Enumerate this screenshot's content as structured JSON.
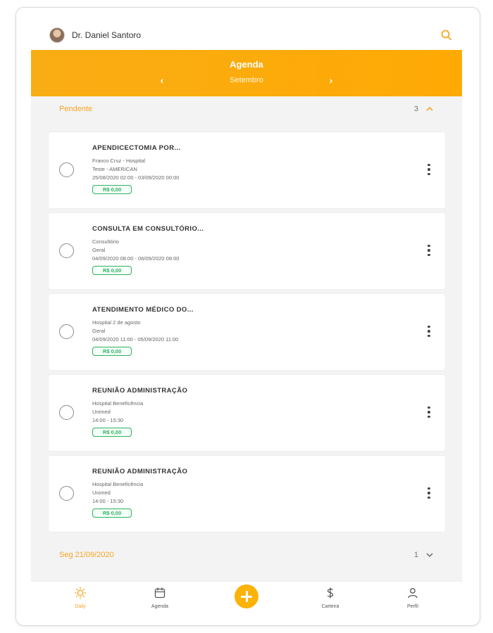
{
  "user": {
    "name": "Dr. Daniel Santoro"
  },
  "header": {
    "title": "Agenda",
    "month": "Setembro",
    "prev_arrow": "‹",
    "next_arrow": "›"
  },
  "sections": [
    {
      "title": "Pendente",
      "count": "3",
      "expanded": true
    },
    {
      "title": "Seg 21/09/2020",
      "count": "1",
      "expanded": false
    }
  ],
  "cards": [
    {
      "title": "APENDICECTOMIA POR...",
      "line1": "Franco Cruz - Hospital",
      "line2": "Teste - AMERICAN",
      "line3": "25/08/2020 02:00 - 03/09/2020 00:00",
      "price": "R$ 0,00"
    },
    {
      "title": "CONSULTA EM CONSULTÓRIO...",
      "line1": "Consultório",
      "line2": "Geral",
      "line3": "04/09/2020 08:00 - 06/09/2020 08:00",
      "price": "R$ 0,00"
    },
    {
      "title": "ATENDIMENTO MÉDICO DO...",
      "line1": "Hospital 2 de agosto",
      "line2": "Geral",
      "line3": "04/09/2020 11:00 - 05/09/2020 11:00",
      "price": "R$ 0,00"
    },
    {
      "title": "REUNIÃO ADMINISTRAÇÃO",
      "line1": "Hospital Beneficência",
      "line2": "Unimed",
      "line3": "14:00 - 15:30",
      "price": "R$ 0,00"
    },
    {
      "title": "REUNIÃO ADMINISTRAÇÃO",
      "line1": "Hospital Beneficência",
      "line2": "Unimed",
      "line3": "14:00 - 15:30",
      "price": "R$ 0,00"
    }
  ],
  "bottom_nav": {
    "daily": "Daily",
    "agenda": "Agenda",
    "carteira": "Carteira",
    "perfil": "Perfil",
    "active": "daily"
  },
  "colors": {
    "accent": "#f5a623",
    "header": "#ffa904",
    "price": "#29b35e"
  },
  "icons": [
    "search-icon",
    "chevron-left-icon",
    "chevron-right-icon",
    "chevron-up-icon",
    "chevron-down-icon",
    "more-vertical-icon",
    "sun-icon",
    "calendar-icon",
    "plus-icon",
    "dollar-icon",
    "user-icon"
  ]
}
